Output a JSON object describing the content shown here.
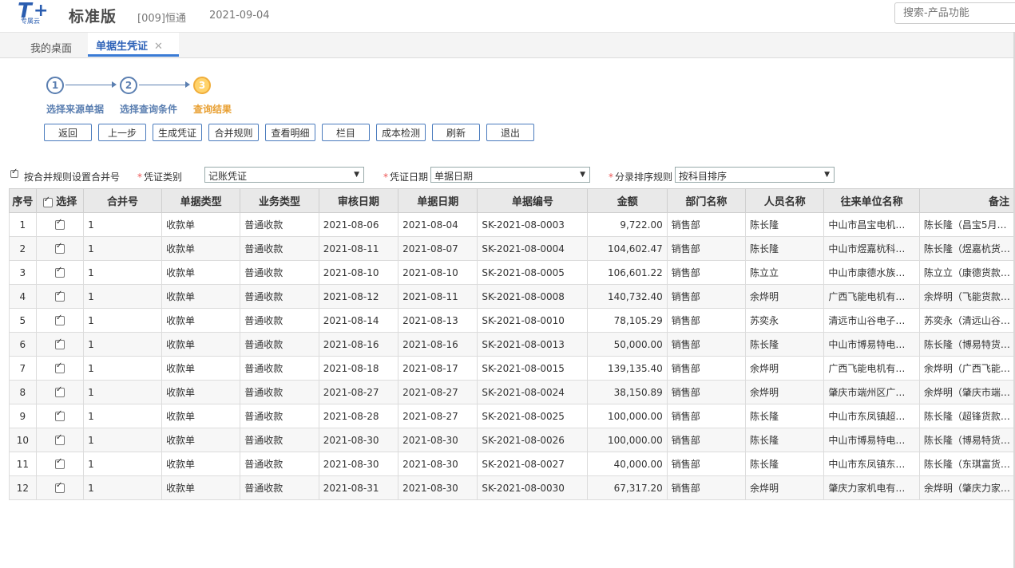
{
  "header": {
    "logo_text": "专属云",
    "edition": "标准版",
    "company": "[009]恒通",
    "date": "2021-09-04",
    "search_placeholder": "搜索-产品功能"
  },
  "tabs": {
    "home": "我的桌面",
    "active": "单据生凭证",
    "close": "✕"
  },
  "steps": [
    {
      "num": "1",
      "label": "选择来源单据"
    },
    {
      "num": "2",
      "label": "选择查询条件"
    },
    {
      "num": "3",
      "label": "查询结果"
    }
  ],
  "buttons": [
    "返回",
    "上一步",
    "生成凭证",
    "合并规则",
    "查看明细",
    "栏目",
    "成本检测",
    "刷新",
    "退出"
  ],
  "options": {
    "merge_rule_label": "按合并规则设置合并号",
    "voucher_type_label": "凭证类别",
    "voucher_type_value": "记账凭证",
    "voucher_date_label": "凭证日期",
    "voucher_date_value": "单据日期",
    "sort_rule_label": "分录排序规则",
    "sort_rule_value": "按科目排序",
    "required_mark": "*"
  },
  "table": {
    "headers": [
      "序号",
      "选择",
      "合并号",
      "单据类型",
      "业务类型",
      "审核日期",
      "单据日期",
      "单据编号",
      "金额",
      "部门名称",
      "人员名称",
      "往来单位名称",
      "备注"
    ],
    "rows": [
      [
        "1",
        "1",
        "收款单",
        "普通收款",
        "2021-08-06",
        "2021-08-04",
        "SK-2021-08-0003",
        "9,722.00",
        "销售部",
        "陈长隆",
        "中山市昌宝电机…",
        "陈长隆（昌宝5月…"
      ],
      [
        "2",
        "1",
        "收款单",
        "普通收款",
        "2021-08-11",
        "2021-08-07",
        "SK-2021-08-0004",
        "104,602.47",
        "销售部",
        "陈长隆",
        "中山市煜嘉杭科…",
        "陈长隆（煜嘉杭货…"
      ],
      [
        "3",
        "1",
        "收款单",
        "普通收款",
        "2021-08-10",
        "2021-08-10",
        "SK-2021-08-0005",
        "106,601.22",
        "销售部",
        "陈立立",
        "中山市康德水族…",
        "陈立立（康德货款…"
      ],
      [
        "4",
        "1",
        "收款单",
        "普通收款",
        "2021-08-12",
        "2021-08-11",
        "SK-2021-08-0008",
        "140,732.40",
        "销售部",
        "余烨明",
        "广西飞能电机有…",
        "余烨明（飞能货款…"
      ],
      [
        "5",
        "1",
        "收款单",
        "普通收款",
        "2021-08-14",
        "2021-08-13",
        "SK-2021-08-0010",
        "78,105.29",
        "销售部",
        "苏奕永",
        "清远市山谷电子…",
        "苏奕永（清远山谷…"
      ],
      [
        "6",
        "1",
        "收款单",
        "普通收款",
        "2021-08-16",
        "2021-08-16",
        "SK-2021-08-0013",
        "50,000.00",
        "销售部",
        "陈长隆",
        "中山市博易特电…",
        "陈长隆（博易特货…"
      ],
      [
        "7",
        "1",
        "收款单",
        "普通收款",
        "2021-08-18",
        "2021-08-17",
        "SK-2021-08-0015",
        "139,135.40",
        "销售部",
        "余烨明",
        "广西飞能电机有…",
        "余烨明（广西飞能…"
      ],
      [
        "8",
        "1",
        "收款单",
        "普通收款",
        "2021-08-27",
        "2021-08-27",
        "SK-2021-08-0024",
        "38,150.89",
        "销售部",
        "余烨明",
        "肇庆市端州区广…",
        "余烨明（肇庆市端…"
      ],
      [
        "9",
        "1",
        "收款单",
        "普通收款",
        "2021-08-28",
        "2021-08-27",
        "SK-2021-08-0025",
        "100,000.00",
        "销售部",
        "陈长隆",
        "中山市东凤镇超…",
        "陈长隆（超锋货款…"
      ],
      [
        "10",
        "1",
        "收款单",
        "普通收款",
        "2021-08-30",
        "2021-08-30",
        "SK-2021-08-0026",
        "100,000.00",
        "销售部",
        "陈长隆",
        "中山市博易特电…",
        "陈长隆（博易特货…"
      ],
      [
        "11",
        "1",
        "收款单",
        "普通收款",
        "2021-08-30",
        "2021-08-30",
        "SK-2021-08-0027",
        "40,000.00",
        "销售部",
        "陈长隆",
        "中山市东凤镇东…",
        "陈长隆（东琪富货…"
      ],
      [
        "12",
        "1",
        "收款单",
        "普通收款",
        "2021-08-31",
        "2021-08-30",
        "SK-2021-08-0030",
        "67,317.20",
        "销售部",
        "余烨明",
        "肇庆力家机电有…",
        "余烨明（肇庆力家…"
      ]
    ]
  },
  "colors": {
    "accent": "#3a7bd5",
    "step": "#5b7fb1",
    "step_current": "#f0ad3a"
  }
}
